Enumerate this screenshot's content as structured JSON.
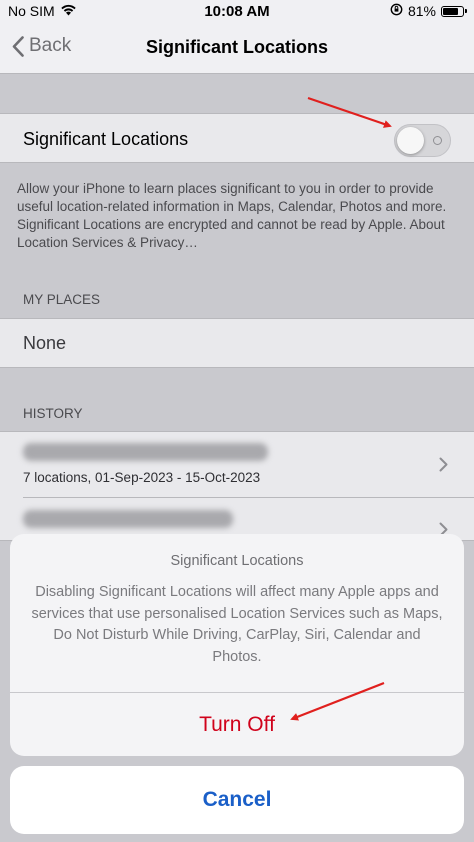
{
  "status_bar": {
    "carrier": "No SIM",
    "time": "10:08 AM",
    "battery": "81%",
    "battery_level": 0.81
  },
  "nav": {
    "back_label": "Back",
    "title": "Significant Locations"
  },
  "significant_locations": {
    "label": "Significant Locations",
    "toggle_on": false
  },
  "description": "Allow your iPhone to learn places significant to you in order to provide useful location-related information in Maps, Calendar, Photos and more. Significant Locations are encrypted and cannot be read by Apple. About Location Services & Privacy…",
  "my_places": {
    "header": "MY PLACES",
    "value": "None"
  },
  "history": {
    "header": "HISTORY",
    "items": [
      {
        "subtitle": "7 locations, 01-Sep-2023 - 15-Oct-2023"
      }
    ]
  },
  "action_sheet": {
    "title": "Significant Locations",
    "message": "Disabling Significant Locations will affect many Apple apps and services that use personalised Location Services such as Maps, Do Not Disturb While Driving, CarPlay, Siri, Calendar and Photos.",
    "destructive_label": "Turn Off",
    "cancel_label": "Cancel"
  },
  "colors": {
    "destructive": "#d0021b",
    "cancel": "#1a5fc8",
    "annotation_arrow": "#e0201e"
  },
  "icons": [
    "wifi-icon",
    "back-chevron-icon",
    "orientation-lock-icon",
    "battery-icon",
    "chevron-right-icon",
    "annotation-arrow"
  ]
}
